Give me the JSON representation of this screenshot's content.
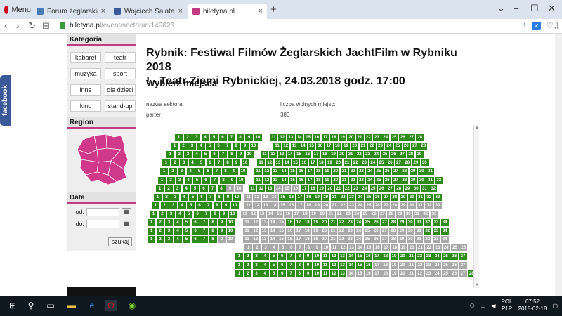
{
  "browser": {
    "menu_label": "Menu",
    "tabs": [
      {
        "title": "Forum żeglarskie • Niepr",
        "color": "#4a7ab5"
      },
      {
        "title": "Wojciech Salata",
        "color": "#3b5998"
      },
      {
        "title": "biletyna.pl",
        "color": "#c33a7e"
      }
    ],
    "url_host": "biletyna.pl",
    "url_path": "/event/sector/id/149626",
    "adblock_count": "1"
  },
  "sidebar": {
    "kategoria_title": "Kategoria",
    "categories": [
      "kabaret",
      "teatr",
      "muzyka",
      "sport",
      "inne",
      "dla dzieci",
      "kino",
      "stand-up"
    ],
    "region_title": "Region",
    "data_title": "Data",
    "od_label": "od:",
    "do_label": "do:",
    "search_button": "szukaj"
  },
  "facebook_tab": "facebook",
  "event": {
    "title_line1": "Rybnik: Festiwal Filmów Żeglarskich JachtFilm w Rybniku 2018",
    "title_line2": "! - Teatr Ziemi Rybnickiej, 24.03.2018 godz. 17:00",
    "choose_seats": "Wybierz miejsca",
    "sector_label": "nazwa sektora:",
    "sector_value": "parter",
    "free_seats_label": "liczba wolnych miejsc:",
    "free_seats_value": "380"
  },
  "seating": {
    "colors": {
      "free": "#2e8b1a",
      "taken": "#a9a9a9"
    },
    "rows": [
      {
        "left_start": 1,
        "left_end": 10,
        "left_taken": [],
        "right_start": 11,
        "right_end": 28,
        "right_taken": []
      },
      {
        "left_start": 1,
        "left_end": 10,
        "left_taken": [],
        "right_start": 11,
        "right_end": 28,
        "right_taken": []
      },
      {
        "left_start": 1,
        "left_end": 10,
        "left_taken": [],
        "right_start": 11,
        "right_end": 29,
        "right_taken": []
      },
      {
        "left_start": 1,
        "left_end": 10,
        "left_taken": [],
        "right_start": 11,
        "right_end": 30,
        "right_taken": []
      },
      {
        "left_start": 1,
        "left_end": 10,
        "left_taken": [],
        "right_start": 11,
        "right_end": 31,
        "right_taken": []
      },
      {
        "left_start": 1,
        "left_end": 10,
        "left_taken": [],
        "right_start": 11,
        "right_end": 32,
        "right_taken": []
      },
      {
        "left_start": 1,
        "left_end": 10,
        "left_taken": [
          9,
          10
        ],
        "right_start": 11,
        "right_end": 32,
        "right_taken": [
          14,
          15,
          16
        ]
      },
      {
        "left_start": 1,
        "left_end": 10,
        "left_taken": [],
        "right_start": 11,
        "right_end": 33,
        "right_taken": [
          11,
          12,
          13,
          14
        ]
      },
      {
        "left_start": 1,
        "left_end": 10,
        "left_taken": [],
        "right_start": 11,
        "right_end": 33,
        "right_taken": [
          11,
          12,
          13,
          14,
          15,
          16,
          17,
          18,
          19,
          20,
          21,
          22,
          23,
          24,
          25,
          26,
          27,
          28,
          29,
          30,
          31,
          32,
          33
        ]
      },
      {
        "left_start": 1,
        "left_end": 10,
        "left_taken": [],
        "right_start": 11,
        "right_end": 33,
        "right_taken": [
          11,
          12,
          13,
          14,
          15,
          16,
          17,
          18,
          19,
          20,
          21,
          22,
          23,
          24,
          25,
          26,
          27,
          28,
          29,
          30,
          31,
          32,
          33
        ]
      },
      {
        "left_start": 1,
        "left_end": 10,
        "left_taken": [],
        "right_start": 11,
        "right_end": 34,
        "right_taken": [
          11,
          12,
          13,
          14,
          15
        ]
      },
      {
        "left_start": 1,
        "left_end": 10,
        "left_taken": [],
        "right_start": 11,
        "right_end": 34,
        "right_taken": [
          11,
          12,
          13,
          14,
          15,
          16,
          17,
          18,
          19,
          20,
          21,
          22,
          23,
          24,
          25,
          26,
          27,
          28,
          29,
          30,
          31
        ]
      },
      {
        "left_start": 1,
        "left_end": 10,
        "left_taken": [
          9,
          10
        ],
        "right_start": 11,
        "right_end": 34,
        "right_taken": [
          11,
          12,
          13,
          14,
          15,
          16,
          17,
          18,
          19,
          20,
          21,
          22,
          23,
          24,
          25,
          26,
          27,
          28,
          29,
          30,
          31,
          32,
          33,
          34
        ]
      },
      {
        "left_start": 0,
        "left_end": -1,
        "left_taken": [],
        "right_start": 1,
        "right_end": 26,
        "right_taken": [
          1,
          2,
          3,
          4,
          5,
          6,
          7,
          8,
          9,
          10,
          11,
          12,
          13,
          14,
          15,
          16,
          17,
          18,
          19,
          20,
          21,
          22,
          23,
          24,
          25,
          26
        ]
      },
      {
        "left_start": 0,
        "left_end": -1,
        "left_taken": [],
        "right_start": 1,
        "right_end": 27,
        "right_taken": []
      },
      {
        "left_start": 0,
        "left_end": -1,
        "left_taken": [],
        "right_start": 1,
        "right_end": 27,
        "right_taken": [
          17,
          18,
          19,
          20,
          21,
          22,
          23,
          24,
          25,
          26,
          27
        ]
      },
      {
        "left_start": 0,
        "left_end": -1,
        "left_taken": [],
        "right_start": 1,
        "right_end": 28,
        "right_taken": [
          14,
          15,
          16,
          17,
          18,
          19,
          20,
          21,
          22,
          23,
          24,
          25,
          26,
          27
        ]
      }
    ]
  },
  "taskbar": {
    "lang_top": "POL",
    "lang_bottom": "PLP",
    "time": "07:52",
    "date": "2018-02-18"
  }
}
